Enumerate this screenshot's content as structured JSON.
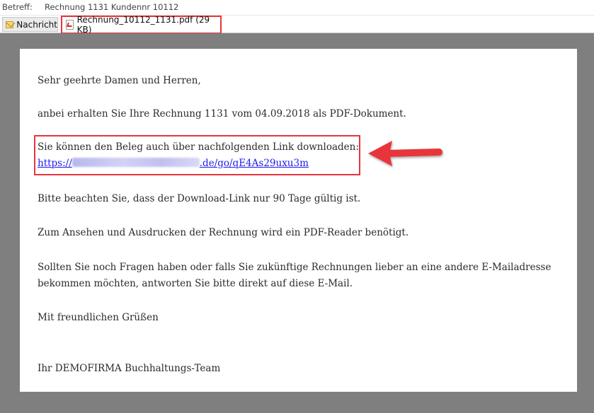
{
  "subject": {
    "label": "Betreff:",
    "value": "Rechnung 1131 Kundennr 10112"
  },
  "tabs": {
    "message_label": "Nachricht",
    "attachment_label": "Rechnung_10112_1131.pdf (29 KB)"
  },
  "icons": {
    "message": "envelope-icon",
    "attachment": "pdf-file-icon",
    "annotation": "red-arrow-left"
  },
  "colors": {
    "highlight": "#e8353b",
    "link": "#1a1aee",
    "background_frame": "#7f7f7f"
  },
  "email": {
    "greeting": "Sehr geehrte Damen und Herren,",
    "intro": "anbei erhalten Sie Ihre Rechnung 1131 vom 04.09.2018 als PDF-Dokument.",
    "download_text": "Sie können den Beleg auch über nachfolgenden Link downloaden:",
    "link_prefix": "https://",
    "link_suffix": ".de/go/qE4As29uxu3m",
    "validity": "Bitte beachten Sie, dass der Download-Link nur 90 Tage gültig ist.",
    "reader_note": "Zum Ansehen und Ausdrucken der Rechnung wird ein PDF-Reader benötigt.",
    "questions_line1": "Sollten Sie noch Fragen haben oder falls Sie zukünftige Rechnungen lieber an eine andere E-Mailadresse",
    "questions_line2": "bekommen möchten, antworten Sie bitte direkt auf diese E-Mail.",
    "closing": "Mit freundlichen Grüßen",
    "signature": "Ihr DEMOFIRMA Buchhaltungs-Team"
  }
}
